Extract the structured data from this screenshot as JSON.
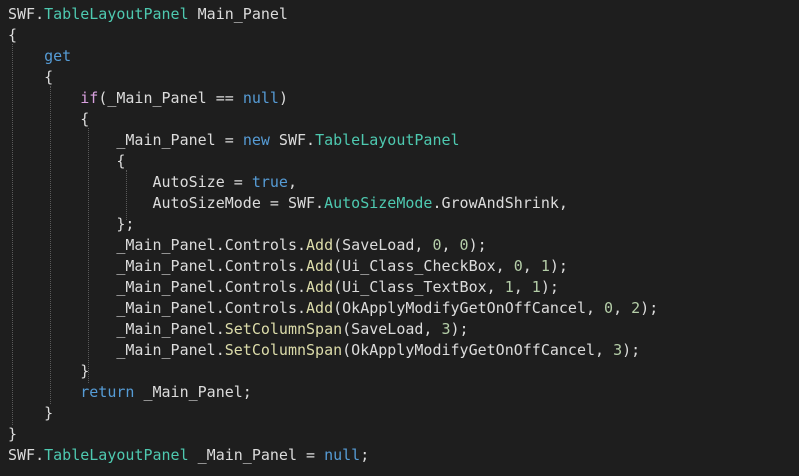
{
  "theme": {
    "background": "#1e1e1e",
    "plain": "#dcdcdc",
    "type": "#4ec9b0",
    "keyword": "#569cd6",
    "control": "#d8a0df",
    "number": "#b5cea8",
    "method": "#dcdcaa",
    "guide": "#5a5a5a"
  },
  "code": {
    "lines": [
      [
        [
          "plain",
          "SWF."
        ],
        [
          "type",
          "TableLayoutPanel"
        ],
        [
          "plain",
          " Main_Panel"
        ]
      ],
      [
        [
          "plain",
          "{"
        ]
      ],
      [
        [
          "plain",
          "    "
        ],
        [
          "kw",
          "get"
        ]
      ],
      [
        [
          "plain",
          "    {"
        ]
      ],
      [
        [
          "plain",
          "        "
        ],
        [
          "ctl",
          "if"
        ],
        [
          "plain",
          "(_Main_Panel == "
        ],
        [
          "kw",
          "null"
        ],
        [
          "plain",
          ")"
        ]
      ],
      [
        [
          "plain",
          "        {"
        ]
      ],
      [
        [
          "plain",
          "            _Main_Panel = "
        ],
        [
          "kw",
          "new"
        ],
        [
          "plain",
          " SWF."
        ],
        [
          "type",
          "TableLayoutPanel"
        ]
      ],
      [
        [
          "plain",
          "            {"
        ]
      ],
      [
        [
          "plain",
          "                AutoSize = "
        ],
        [
          "kw",
          "true"
        ],
        [
          "plain",
          ","
        ]
      ],
      [
        [
          "plain",
          "                AutoSizeMode = SWF."
        ],
        [
          "type",
          "AutoSizeMode"
        ],
        [
          "plain",
          ".GrowAndShrink,"
        ]
      ],
      [
        [
          "plain",
          "            };"
        ]
      ],
      [
        [
          "plain",
          "            _Main_Panel.Controls."
        ],
        [
          "meth",
          "Add"
        ],
        [
          "plain",
          "(SaveLoad, "
        ],
        [
          "num",
          "0"
        ],
        [
          "plain",
          ", "
        ],
        [
          "num",
          "0"
        ],
        [
          "plain",
          ");"
        ]
      ],
      [
        [
          "plain",
          "            _Main_Panel.Controls."
        ],
        [
          "meth",
          "Add"
        ],
        [
          "plain",
          "(Ui_Class_CheckBox, "
        ],
        [
          "num",
          "0"
        ],
        [
          "plain",
          ", "
        ],
        [
          "num",
          "1"
        ],
        [
          "plain",
          ");"
        ]
      ],
      [
        [
          "plain",
          "            _Main_Panel.Controls."
        ],
        [
          "meth",
          "Add"
        ],
        [
          "plain",
          "(Ui_Class_TextBox, "
        ],
        [
          "num",
          "1"
        ],
        [
          "plain",
          ", "
        ],
        [
          "num",
          "1"
        ],
        [
          "plain",
          ");"
        ]
      ],
      [
        [
          "plain",
          "            _Main_Panel.Controls."
        ],
        [
          "meth",
          "Add"
        ],
        [
          "plain",
          "(OkApplyModifyGetOnOffCancel, "
        ],
        [
          "num",
          "0"
        ],
        [
          "plain",
          ", "
        ],
        [
          "num",
          "2"
        ],
        [
          "plain",
          ");"
        ]
      ],
      [
        [
          "plain",
          "            _Main_Panel."
        ],
        [
          "meth",
          "SetColumnSpan"
        ],
        [
          "plain",
          "(SaveLoad, "
        ],
        [
          "num",
          "3"
        ],
        [
          "plain",
          ");"
        ]
      ],
      [
        [
          "plain",
          "            _Main_Panel."
        ],
        [
          "meth",
          "SetColumnSpan"
        ],
        [
          "plain",
          "(OkApplyModifyGetOnOffCancel, "
        ],
        [
          "num",
          "3"
        ],
        [
          "plain",
          ");"
        ]
      ],
      [
        [
          "plain",
          "        }"
        ]
      ],
      [
        [
          "plain",
          "        "
        ],
        [
          "kw",
          "return"
        ],
        [
          "plain",
          " _Main_Panel;"
        ]
      ],
      [
        [
          "plain",
          "    }"
        ]
      ],
      [
        [
          "plain",
          "}"
        ]
      ],
      [
        [
          "plain",
          "SWF."
        ],
        [
          "type",
          "TableLayoutPanel"
        ],
        [
          "plain",
          " _Main_Panel = "
        ],
        [
          "kw",
          "null"
        ],
        [
          "plain",
          ";"
        ]
      ]
    ]
  }
}
